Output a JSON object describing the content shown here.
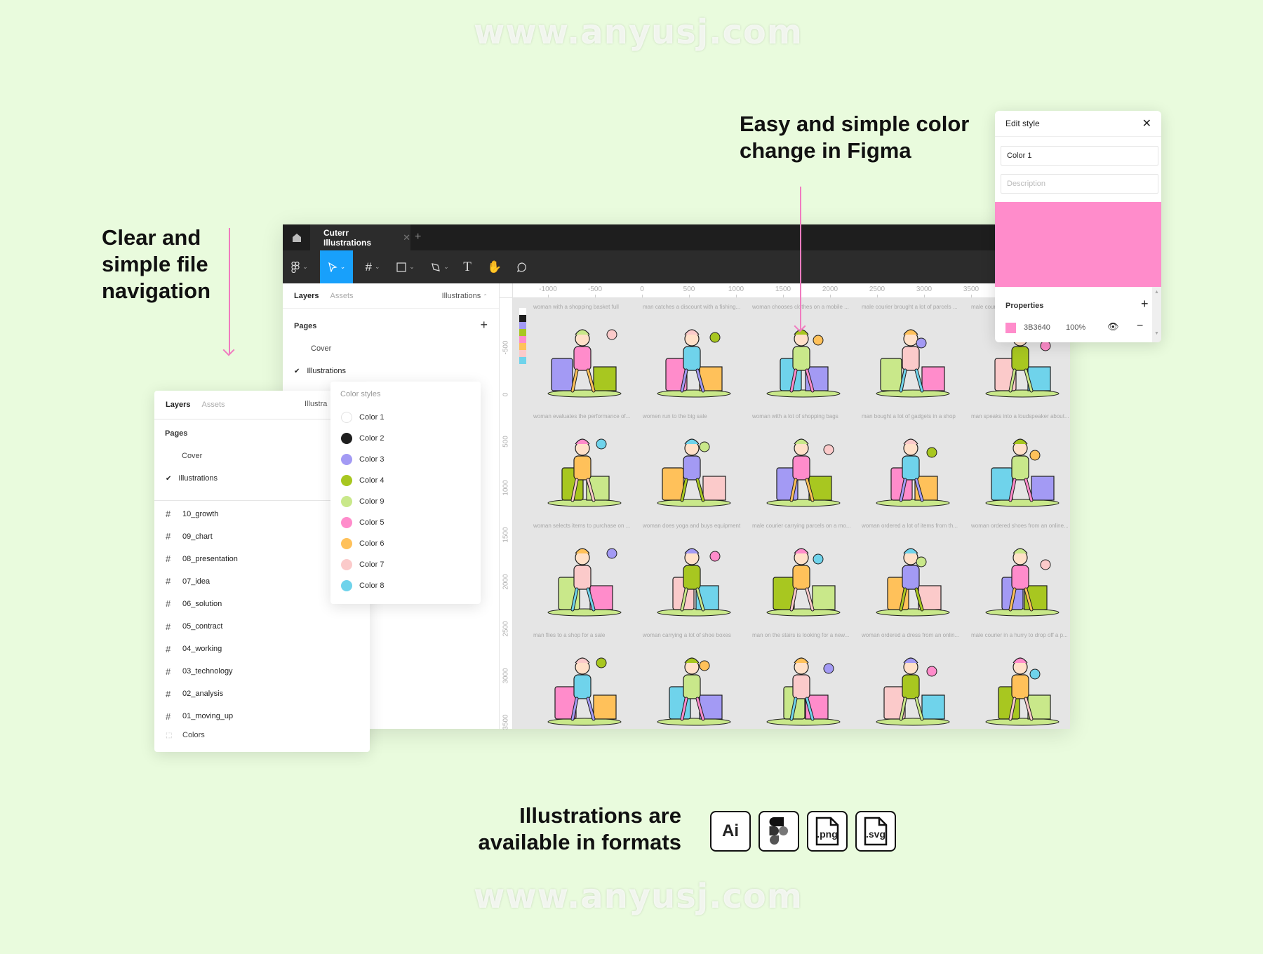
{
  "watermark": "www.anyusj.com",
  "headings": {
    "navigation": [
      "Clear and",
      "simple file",
      "navigation"
    ],
    "color_change": [
      "Easy and simple color",
      "change in Figma"
    ],
    "formats": [
      "Illustrations are",
      "available in formats"
    ]
  },
  "formats": [
    {
      "icon": "adobe-illustrator-icon",
      "label": "Ai"
    },
    {
      "icon": "figma-logo-icon",
      "label": ""
    },
    {
      "icon": "png-file-icon",
      "label": ".png"
    },
    {
      "icon": "svg-file-icon",
      "label": ".svg"
    }
  ],
  "window": {
    "tab_title": "Cuterr Illustrations",
    "tools": [
      "figma-menu-icon",
      "move-icon",
      "frame-icon",
      "rectangle-icon",
      "pen-icon",
      "text-icon",
      "hand-icon",
      "comment-icon"
    ],
    "left_panel": {
      "tab_layers": "Layers",
      "tab_assets": "Assets",
      "page_selector": "Illustrations",
      "pages_label": "Pages",
      "pages": [
        {
          "name": "Cover",
          "checked": false
        },
        {
          "name": "Illustrations",
          "checked": true
        }
      ]
    },
    "ruler_top": [
      "-1000",
      "-500",
      "0",
      "500",
      "1000",
      "1500",
      "2000",
      "2500",
      "3000",
      "3500"
    ],
    "ruler_left": [
      "-500",
      "0",
      "500",
      "1000",
      "1500",
      "2000",
      "2500",
      "3000",
      "3500"
    ],
    "illustrations": [
      "woman with a shopping basket full",
      "man catches a discount with a fishing...",
      "woman chooses clothes on a mobile ...",
      "male courier brought a lot of parcels ...",
      "male courier ...",
      "woman evaluates the performance of...",
      "women run to the big sale",
      "woman with a lot of shopping bags",
      "man bought a lot of gadgets in a shop",
      "man speaks into a loudspeaker about...",
      "woman selects items to purchase on ...",
      "woman does yoga and buys equipment",
      "male courier carrying parcels on a mo...",
      "woman ordered a lot of items from th...",
      "woman ordered shoes from an online...",
      "man flies to a shop for a sale",
      "woman carrying a lot of shoe boxes",
      "man on the stairs is looking for a new...",
      "woman ordered a dress from an onlin...",
      "male courier in a hurry to drop off a p..."
    ]
  },
  "edit_style": {
    "title": "Edit style",
    "name_value": "Color 1",
    "description_placeholder": "Description",
    "preview_color": "#ff8ccb",
    "properties_label": "Properties",
    "fill": {
      "hex": "3B3640",
      "opacity": "100%",
      "swatch": "#ff8ccb"
    }
  },
  "color_styles": {
    "title": "Color styles",
    "items": [
      {
        "name": "Color 1",
        "color": "#ffffff"
      },
      {
        "name": "Color 2",
        "color": "#1e1e1e"
      },
      {
        "name": "Color 3",
        "color": "#a39af4"
      },
      {
        "name": "Color 4",
        "color": "#a8c720"
      },
      {
        "name": "Color 9",
        "color": "#c9e88a"
      },
      {
        "name": "Color 5",
        "color": "#ff8ccb"
      },
      {
        "name": "Color 6",
        "color": "#ffc15a"
      },
      {
        "name": "Color 7",
        "color": "#fbcaca"
      },
      {
        "name": "Color 8",
        "color": "#6fd3eb"
      }
    ]
  },
  "layers_panel": {
    "tab_layers": "Layers",
    "tab_assets": "Assets",
    "page_selector": "Illustra",
    "pages_label": "Pages",
    "pages": [
      {
        "name": "Cover",
        "checked": false
      },
      {
        "name": "Illustrations",
        "checked": true
      }
    ],
    "frames": [
      "10_growth",
      "09_chart",
      "08_presentation",
      "07_idea",
      "06_solution",
      "05_contract",
      "04_working",
      "03_technology",
      "02_analysis",
      "01_moving_up"
    ],
    "colors_layer": "Colors"
  },
  "colors": {
    "background": "#e9fbdd",
    "accent_blue": "#18a0fb",
    "arrow_pink": "#f07bbf",
    "canvas": "#e5e5e5"
  }
}
